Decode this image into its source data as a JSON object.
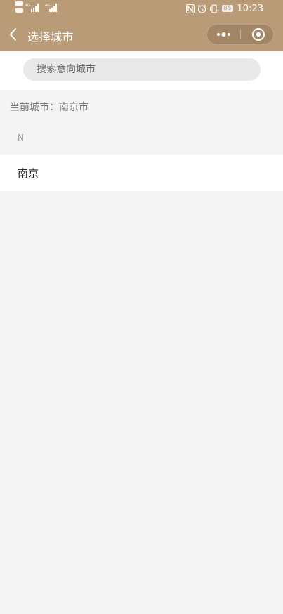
{
  "status_bar": {
    "network_left": "HD 4G 4G",
    "time": "10:23",
    "battery": "85",
    "icons": [
      "nfc-icon",
      "alarm-icon",
      "vibrate-icon",
      "battery-icon"
    ]
  },
  "nav": {
    "title": "选择城市",
    "back_icon": "chevron-left-icon",
    "more_icon": "more-dots-icon",
    "close_icon": "target-circle-icon"
  },
  "search": {
    "placeholder": "搜索意向城市",
    "value": ""
  },
  "current_city": {
    "text": "当前城市：南京市"
  },
  "city_index": [
    {
      "letter": "N",
      "cities": [
        "南京"
      ]
    }
  ],
  "colors": {
    "header_bg": "#b99b78",
    "page_bg": "#f4f4f4",
    "search_bg": "#e9e9e9"
  }
}
